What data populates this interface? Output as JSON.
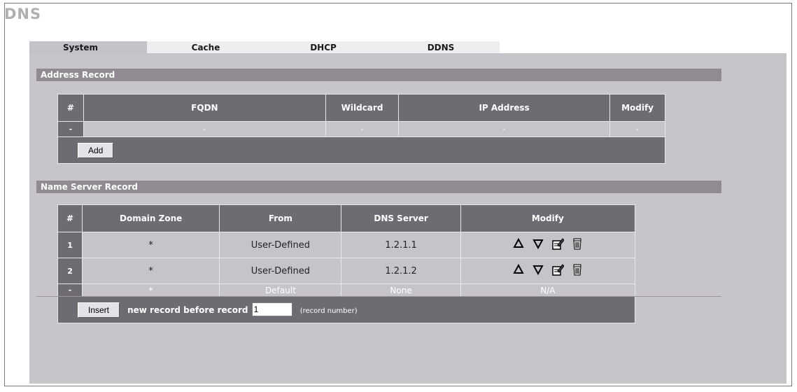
{
  "page": {
    "title": "DNS"
  },
  "tabs": [
    "System",
    "Cache",
    "DHCP",
    "DDNS"
  ],
  "address_record": {
    "title": "Address Record",
    "headers": [
      "#",
      "FQDN",
      "Wildcard",
      "IP Address",
      "Modify"
    ],
    "rows": [
      [
        "-",
        "-",
        "-",
        "-",
        "-"
      ]
    ],
    "add_label": "Add"
  },
  "name_server_record": {
    "title": "Name Server Record",
    "headers": [
      "#",
      "Domain Zone",
      "From",
      "DNS Server",
      "Modify"
    ],
    "rows": [
      {
        "num": "1",
        "zone": "*",
        "from": "User-Defined",
        "server": "1.2.1.1",
        "modify": "icons"
      },
      {
        "num": "2",
        "zone": "*",
        "from": "User-Defined",
        "server": "1.2.1.2",
        "modify": "icons"
      },
      {
        "num": "-",
        "zone": "*",
        "from": "Default",
        "server": "None",
        "modify": "N/A"
      }
    ],
    "insert_label": "Insert",
    "insert_text": "new record before record",
    "insert_value": "1",
    "insert_hint": "(record number)"
  },
  "icons": {
    "up": "move-up-icon",
    "down": "move-down-icon",
    "edit": "edit-icon",
    "delete": "delete-icon"
  }
}
